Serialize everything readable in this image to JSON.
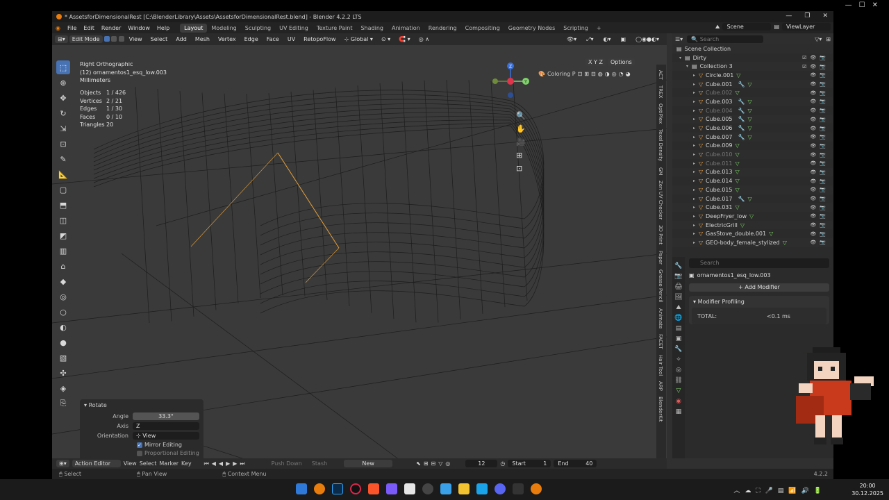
{
  "window": {
    "title": "* AssetsforDimensionalRest [C:\\BlenderLibrary\\Assets\\AssetsforDimensionalRest.blend] - Blender 4.2.2 LTS"
  },
  "menu": [
    "File",
    "Edit",
    "Render",
    "Window",
    "Help"
  ],
  "workspaces": [
    "Layout",
    "Modeling",
    "Sculpting",
    "UV Editing",
    "Texture Paint",
    "Shading",
    "Animation",
    "Rendering",
    "Compositing",
    "Geometry Nodes",
    "Scripting"
  ],
  "active_workspace": "Layout",
  "scene": "Scene",
  "view_layer": "ViewLayer",
  "viewport": {
    "mode": "Edit Mode",
    "menus": [
      "View",
      "Select",
      "Add",
      "Mesh",
      "Vertex",
      "Edge",
      "Face",
      "UV",
      "RetopoFlow"
    ],
    "orientation": "Global",
    "view_name": "Right Orthographic",
    "object_label": "(12) ornamentos1_esq_low.003",
    "units": "Millimeters",
    "options": "Options",
    "axes_lock": "X Y Z",
    "coloring": "Coloring P",
    "stats": [
      {
        "k": "Objects",
        "v": "1 / 426"
      },
      {
        "k": "Vertices",
        "v": "2 / 21"
      },
      {
        "k": "Edges",
        "v": "1 / 30"
      },
      {
        "k": "Faces",
        "v": "0 / 10"
      },
      {
        "k": "Triangles",
        "v": "20"
      }
    ],
    "sidebar_tabs": [
      "ACT",
      "TREX",
      "OptiPlex",
      "Texel Density",
      "GM",
      "Zen UV Checker",
      "3D Print",
      "Paper",
      "Grease Pencil",
      "Animate",
      "FACET",
      "Hair Tool",
      "ARP",
      "BlenderKit"
    ],
    "gizmo": {
      "z": "Z",
      "y": "Y"
    }
  },
  "redo": {
    "title": "Rotate",
    "angle_label": "Angle",
    "angle_value": "33.3°",
    "axis_label": "Axis",
    "axis_value": "Z",
    "orientation_label": "Orientation",
    "orientation_value": "View",
    "mirror_editing": "Mirror Editing",
    "proportional_editing": "Proportional Editing"
  },
  "timeline": {
    "editor": "Action Editor",
    "menus": [
      "View",
      "Select",
      "Marker",
      "Key"
    ],
    "push_down": "Push Down",
    "stash": "Stash",
    "new": "New",
    "frame": "12",
    "start_label": "Start",
    "start": "1",
    "end_label": "End",
    "end": "40"
  },
  "status": {
    "select": "Select",
    "pan": "Pan View",
    "context": "Context Menu",
    "version": "4.2.2"
  },
  "outliner": {
    "search_placeholder": "Search",
    "root": "Scene Collection",
    "collection": "Dirty",
    "subcollection": "Collection 3",
    "items": [
      {
        "name": "Circle.001",
        "dim": false,
        "mod": false
      },
      {
        "name": "Cube.001",
        "dim": false,
        "mod": true
      },
      {
        "name": "Cube.002",
        "dim": true,
        "mod": false
      },
      {
        "name": "Cube.003",
        "dim": false,
        "mod": true
      },
      {
        "name": "Cube.004",
        "dim": true,
        "mod": true
      },
      {
        "name": "Cube.005",
        "dim": false,
        "mod": true
      },
      {
        "name": "Cube.006",
        "dim": false,
        "mod": true
      },
      {
        "name": "Cube.007",
        "dim": false,
        "mod": true
      },
      {
        "name": "Cube.009",
        "dim": false,
        "mod": false
      },
      {
        "name": "Cube.010",
        "dim": true,
        "mod": false
      },
      {
        "name": "Cube.011",
        "dim": true,
        "mod": false
      },
      {
        "name": "Cube.013",
        "dim": false,
        "mod": false
      },
      {
        "name": "Cube.014",
        "dim": false,
        "mod": false
      },
      {
        "name": "Cube.015",
        "dim": false,
        "mod": false
      },
      {
        "name": "Cube.017",
        "dim": false,
        "mod": true
      },
      {
        "name": "Cube.031",
        "dim": false,
        "mod": false
      },
      {
        "name": "DeepFryer_low",
        "dim": false,
        "mod": false
      },
      {
        "name": "ElectricGrill",
        "dim": false,
        "mod": false
      },
      {
        "name": "GasStove_double.001",
        "dim": false,
        "mod": false
      },
      {
        "name": "GEO-body_female_stylized",
        "dim": false,
        "mod": false
      }
    ]
  },
  "properties": {
    "search_placeholder": "Search",
    "object": "ornamentos1_esq_low.003",
    "add_modifier": "Add Modifier",
    "panel_title": "Modifier Profiling",
    "total_label": "TOTAL:",
    "total_value": "<0.1 ms"
  },
  "taskbar": {
    "time": "20:00",
    "date": "30.12.2025"
  },
  "colors": {
    "accent": "#4772b3",
    "selected_edge": "#e8a23a",
    "object_icon": "#e8a24a",
    "mesh_icon": "#7fd36a"
  }
}
